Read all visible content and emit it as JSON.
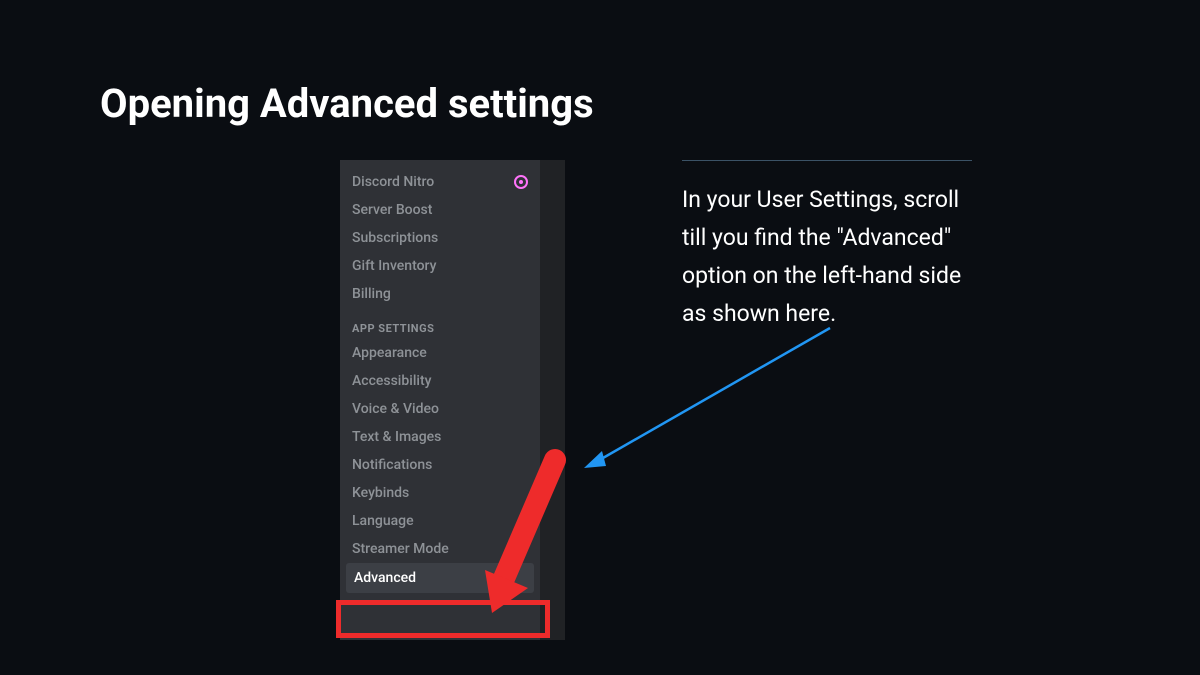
{
  "slide": {
    "title": "Opening Advanced settings"
  },
  "sidebar": {
    "items": [
      "Discord Nitro",
      "Server Boost",
      "Subscriptions",
      "Gift Inventory",
      "Billing"
    ],
    "section_header": "APP SETTINGS",
    "app_items": [
      "Appearance",
      "Accessibility",
      "Voice & Video",
      "Text & Images",
      "Notifications",
      "Keybinds",
      "Language",
      "Streamer Mode",
      "Advanced"
    ]
  },
  "instruction": {
    "text": "In your User Settings, scroll till you find the \"Advanced\" option on the left-hand side as shown here."
  }
}
